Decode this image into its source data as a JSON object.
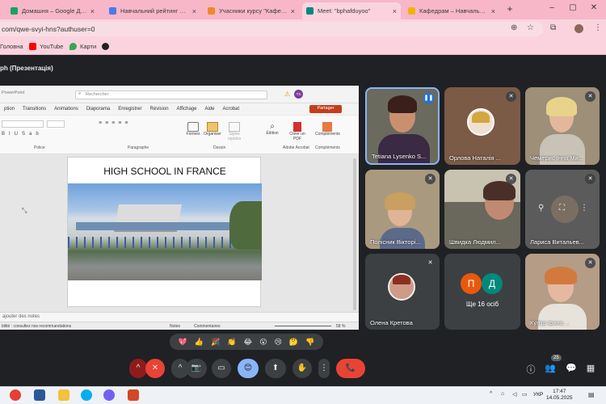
{
  "browser": {
    "tabs": [
      {
        "label": "Домашня – Google Диск",
        "color": "#1aa260"
      },
      {
        "label": "Навчальний рейтинг Кул...",
        "color": "#4c7be8"
      },
      {
        "label": "Учасники курсу \"Кафедра",
        "color": "#f08a24"
      },
      {
        "label": "Meet: \"bphafduyoo\"",
        "color": "#00897b"
      },
      {
        "label": "Кафедрам – Навчально-н...",
        "color": "#f0b400"
      }
    ],
    "new_tab": "+",
    "url": "com/qwe-svyi-hns?authuser=0",
    "bookmarks": [
      {
        "label": "Головна",
        "color": "#d0d0d0"
      },
      {
        "label": "YouTube",
        "color": "#ff0000"
      },
      {
        "label": "Карти",
        "color": "#34a853"
      },
      {
        "label": "",
        "color": "#222"
      }
    ]
  },
  "meet": {
    "title": "ph (Презентація)",
    "participants": [
      {
        "name": "Tetiana Lysenko S...",
        "bg": "#6b6a5e"
      },
      {
        "name": "Орлова Наталія ...",
        "bg": "#7b5a46"
      },
      {
        "name": "Чемерис Інна Ми...",
        "bg": "#9d8f78"
      },
      {
        "name": "Полісник Вікторі...",
        "bg": "#a99a7f"
      },
      {
        "name": "Швидка Людмил...",
        "bg": "#6a675c"
      },
      {
        "name": "Лариса Витальев...",
        "bg": "#5b5b5b"
      },
      {
        "name": "Олена Кретова",
        "bg": "#3c4043"
      },
      {
        "name": "Ще 16 осіб",
        "bg": "#3c4043"
      },
      {
        "name": "Куліш Ірина ...",
        "bg": "#b59c86"
      }
    ],
    "more_avatars": [
      "П",
      "Д"
    ],
    "reactions": [
      "💖",
      "👍",
      "🎉",
      "👏",
      "😂",
      "😮",
      "😢",
      "🤔",
      "👎"
    ],
    "participant_count": "25",
    "controls": {
      "mic": "🎤",
      "video": "📷",
      "present": "⬆",
      "emoji": "😊",
      "hand": "✋",
      "more": "⋮",
      "leave": "📞"
    }
  },
  "powerpoint": {
    "app_label": "PowerPoint",
    "search_placeholder": "Rechercher",
    "user_initial": "TS",
    "menu": [
      "ption",
      "Transitions",
      "Animations",
      "Diaporama",
      "Enregistrer",
      "Révision",
      "Affichage",
      "Aide",
      "Acrobat"
    ],
    "share_label": "Partager",
    "ribbon_groups": [
      "Police",
      "Paragraphe",
      "Dessin",
      "Adobe Acrobat",
      "Compléments"
    ],
    "ribbon_buttons": [
      "Formes",
      "Organiser",
      "Styles rapides",
      "Édition",
      "Créer un PDF",
      "Compléments"
    ],
    "slide_title": "HIGH SCHOOL IN FRANCE",
    "notes_placeholder": "ajouter des notes",
    "status_text": "bilité : consultez nos recommandations",
    "status_notes": "Notes",
    "status_comments": "Commentaires",
    "zoom": "58 %"
  },
  "taskbar": {
    "lang": "УКР",
    "time": "17:47",
    "date": "14.05.2025",
    "apps": [
      {
        "name": "chrome",
        "color": "#e34133"
      },
      {
        "name": "word",
        "color": "#2b579a"
      },
      {
        "name": "explorer",
        "color": "#f3c13a"
      },
      {
        "name": "skype",
        "color": "#00aff0"
      },
      {
        "name": "viber",
        "color": "#7360f2"
      },
      {
        "name": "powerpoint",
        "color": "#d24726"
      }
    ]
  }
}
